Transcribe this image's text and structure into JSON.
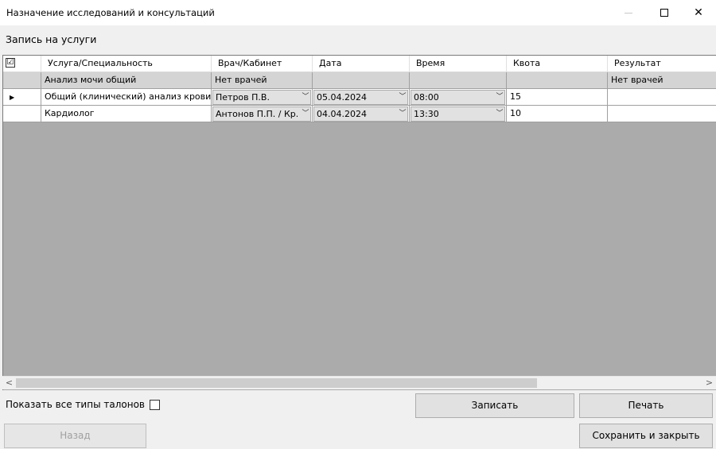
{
  "window": {
    "title": "Назначение исследований и консультаций"
  },
  "section_label": "Запись на услуги",
  "grid": {
    "columns": [
      "Услуга/Специальность",
      "Врач/Кабинет",
      "Дата",
      "Время",
      "Квота",
      "Результат"
    ],
    "header_checkbox": "☑",
    "rows": [
      {
        "service": "Анализ мочи общий",
        "doctor": "Нет врачей",
        "date": "",
        "time": "",
        "quota": "",
        "result": "Нет врачей"
      },
      {
        "service": "Общий (клинический) анализ крови",
        "doctor": "Петров П.В.",
        "date": "05.04.2024",
        "time": "08:00",
        "quota": "15",
        "result": ""
      },
      {
        "service": "Кардиолог",
        "doctor": "Антонов П.П. / Кр...",
        "date": "04.04.2024",
        "time": "13:30",
        "quota": "10",
        "result": ""
      }
    ],
    "current_row_marker": "▶",
    "dropdown_glyph": "﹀"
  },
  "show_all_label": "Показать все типы талонов",
  "buttons": {
    "zapisat": "Записать",
    "pechat": "Печать",
    "nazad": "Назад",
    "save_close": "Сохранить и закрыть"
  },
  "window_controls": {
    "maximize": "☐",
    "close": "✕"
  },
  "scroll": {
    "left": "<",
    "right": ">"
  }
}
